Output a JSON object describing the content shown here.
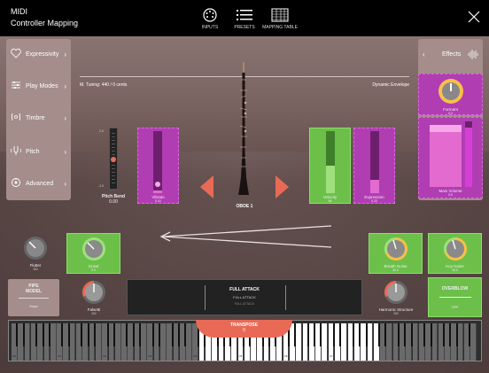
{
  "header": {
    "title_line1": "MIDI",
    "title_line2": "Controller Mapping",
    "buttons": [
      {
        "label": "INPUTS",
        "icon": "midi-port-icon"
      },
      {
        "label": "PRESETS",
        "icon": "list-icon"
      },
      {
        "label": "MAPPING TABLE",
        "icon": "grid-table-icon"
      }
    ],
    "close_icon": "close-icon"
  },
  "sidebar": {
    "items": [
      {
        "label": "Expressivity",
        "icon": "heart-icon"
      },
      {
        "label": "Play Modes",
        "icon": "sliders-icon"
      },
      {
        "label": "Timbre",
        "icon": "timbre-icon"
      },
      {
        "label": "Pitch",
        "icon": "tuning-fork-icon"
      },
      {
        "label": "Advanced",
        "icon": "advanced-icon"
      }
    ]
  },
  "effects": {
    "label": "Effects",
    "icon": "waveform-icon"
  },
  "stage": {
    "tuning": "M. Tuning: 440 / 0 cents",
    "dynamic_envelope": "Dynamic Envelope",
    "instrument": "OBOE 1"
  },
  "controls": {
    "pitch_bend": {
      "label": "Pitch Bend",
      "value": "0.00",
      "scale_top": "2.0",
      "scale_bottom": "-2.0",
      "level": 0.5
    },
    "vibrato": {
      "label": "Vibrato",
      "value": "0.01",
      "level": 0.05
    },
    "velocity": {
      "label": "Velocity",
      "value": "56",
      "level": 0.45
    },
    "expression": {
      "label": "Expression",
      "value": "0.22",
      "level": 0.22
    },
    "formant": {
      "label": "Formant",
      "value": "0.3",
      "level": 0.5
    },
    "main_volume": {
      "label": "Main Volume",
      "value": "0.9",
      "level": 0.9
    },
    "flutter": {
      "label": "Flutter",
      "value": "0.0"
    },
    "growl": {
      "label": "Growl",
      "value": "0.0"
    },
    "breath_noise": {
      "label": "Breath Noise",
      "value": "30.0"
    },
    "key_noise": {
      "label": "Key Noise",
      "value": "30.0"
    },
    "pipe_model": {
      "label_line1": "PIPE",
      "label_line2": "MODEL",
      "sub": "Keys"
    },
    "falsetti": {
      "label": "Falsetti",
      "value": "0.0"
    },
    "harmonic_structure": {
      "label": "Harmonic Structure",
      "value": "0.0"
    },
    "overblow": {
      "label": "OVERBLOW",
      "value": "OFF"
    },
    "attack": {
      "title": "FULL ATTACK",
      "line2": "FULL ATTACK",
      "line3": "FULL ATTACK"
    },
    "transpose": {
      "label": "TRANSPOSE",
      "value": "0"
    }
  },
  "keyboard": {
    "octave_labels": [
      "C0",
      "C1",
      "C2",
      "C3",
      "C4",
      "C5",
      "C6",
      "C7"
    ]
  },
  "colors": {
    "green": "#6cc04a",
    "magenta": "#b13db3",
    "accent": "#e86a56"
  }
}
